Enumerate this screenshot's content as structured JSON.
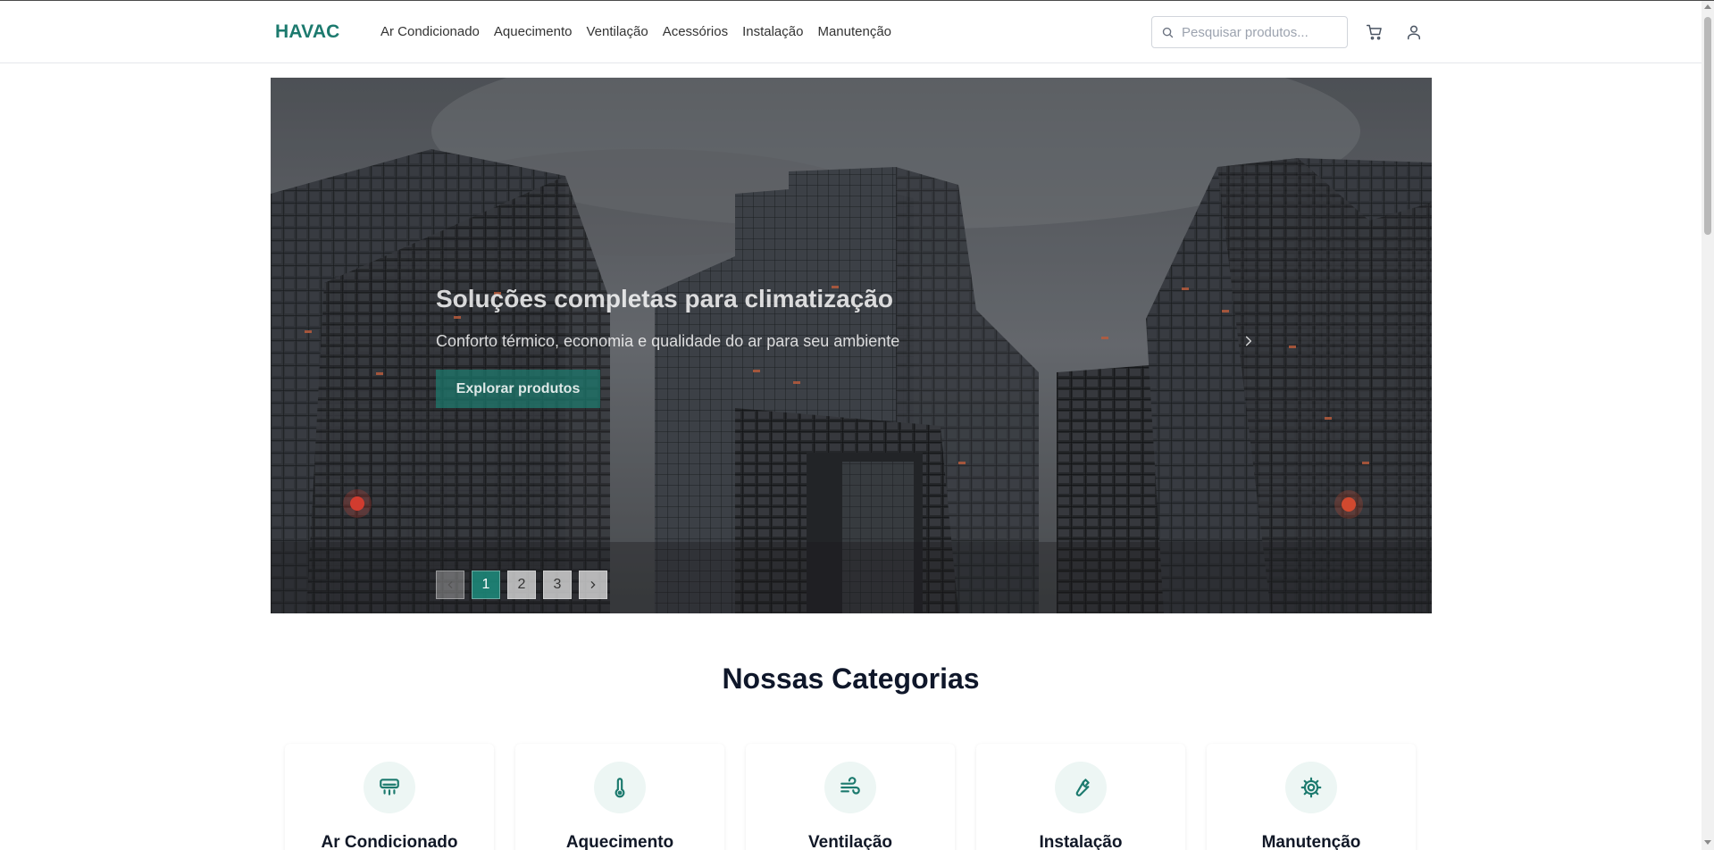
{
  "header": {
    "logo": "HAVAC",
    "nav": [
      "Ar Condicionado",
      "Aquecimento",
      "Ventilação",
      "Acessórios",
      "Instalação",
      "Manutenção"
    ],
    "search_placeholder": "Pesquisar produtos...",
    "icons": [
      "search-icon",
      "cart-icon",
      "user-icon"
    ]
  },
  "hero": {
    "title": "Soluções completas para climatização",
    "subtitle": "Conforto térmico, economia e qualidade do ar para seu ambiente",
    "cta": "Explorar produtos",
    "pages": [
      "1",
      "2",
      "3"
    ],
    "active_page": "1"
  },
  "categories": {
    "title": "Nossas Categorias",
    "items": [
      {
        "label": "Ar Condicionado",
        "icon": "air-conditioner-icon"
      },
      {
        "label": "Aquecimento",
        "icon": "thermometer-icon"
      },
      {
        "label": "Ventilação",
        "icon": "wind-icon"
      },
      {
        "label": "Instalação",
        "icon": "wrench-icon"
      },
      {
        "label": "Manutenção",
        "icon": "gear-icon"
      }
    ]
  },
  "colors": {
    "accent": "#1c7a6e",
    "icon_bg": "#edf6f4"
  }
}
